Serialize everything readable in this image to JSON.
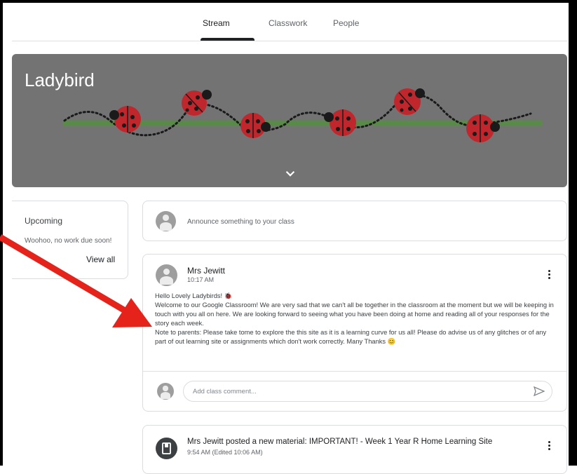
{
  "nav": {
    "tabs": [
      {
        "label": "Stream",
        "active": true
      },
      {
        "label": "Classwork",
        "active": false
      },
      {
        "label": "People",
        "active": false
      }
    ]
  },
  "banner": {
    "title": "Ladybird",
    "background_color": "#737373",
    "expand_icon": "chevron-down-icon"
  },
  "upcoming": {
    "title": "Upcoming",
    "text": "Woohoo, no work due soon!",
    "link": "View all"
  },
  "announce": {
    "placeholder": "Announce something to your class"
  },
  "post": {
    "author": "Mrs Jewitt",
    "time": "10:17 AM",
    "greeting": "Hello Lovely Ladybirds! 🐞",
    "paragraph1": "Welcome to our Google Classroom! We are very sad that we can't all be together in the classroom at the moment but we will be keeping in touch with you all on here. We are looking forward to seeing what you have been doing at home and reading all of your responses for the story each week.",
    "paragraph2": "Note to parents: Please take tome to explore the this site as it is a learning curve for us all! Please do advise us of any glitches or of any part of out learning site or assignments which don't work correctly. Many Thanks 😊",
    "comment_placeholder": "Add class comment..."
  },
  "material": {
    "title": "Mrs Jewitt posted a new material: IMPORTANT! - Week 1 Year R Home Learning Site",
    "time": "9:54 AM (Edited 10:06 AM)"
  },
  "colors": {
    "annotation_arrow": "#e5231b",
    "ladybird_red": "#c0272d",
    "stem_green": "#5a8a4a"
  }
}
